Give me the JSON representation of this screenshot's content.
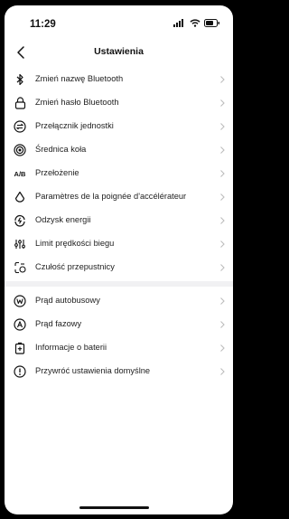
{
  "status_bar": {
    "time": "11:29"
  },
  "nav": {
    "title": "Ustawienia"
  },
  "group1": [
    {
      "label": "Zmień nazwę Bluetooth",
      "icon": "bluetooth-icon"
    },
    {
      "label": "Zmień hasło Bluetooth",
      "icon": "lock-icon"
    },
    {
      "label": "Przełącznik jednostki",
      "icon": "unit-switch-icon"
    },
    {
      "label": "Średnica koła",
      "icon": "wheel-icon"
    },
    {
      "label": "Przełożenie",
      "icon": "ab-icon"
    },
    {
      "label": "Paramètres de la poignée d'accélérateur",
      "icon": "throttle-drop-icon"
    },
    {
      "label": "Odzysk energii",
      "icon": "energy-recovery-icon"
    },
    {
      "label": "Limit prędkości biegu",
      "icon": "speed-limit-icon"
    },
    {
      "label": "Czułość przepustnicy",
      "icon": "throttle-sensitivity-icon"
    }
  ],
  "group2": [
    {
      "label": "Prąd autobusowy",
      "icon": "bus-current-icon"
    },
    {
      "label": "Prąd fazowy",
      "icon": "phase-current-icon"
    },
    {
      "label": "Informacje o baterii",
      "icon": "battery-icon"
    },
    {
      "label": "Przywróć ustawienia domyślne",
      "icon": "restore-defaults-icon"
    }
  ],
  "ab_glyph": "A/B"
}
